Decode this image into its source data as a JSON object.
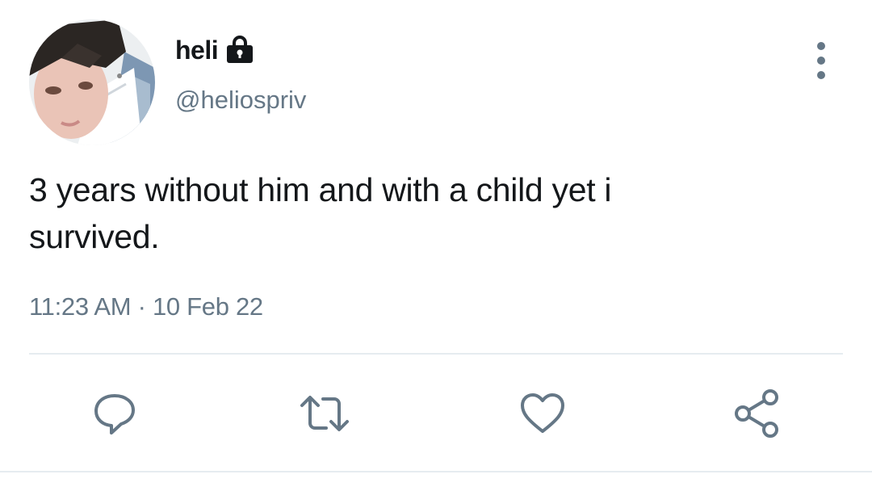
{
  "author": {
    "display_name": "heli",
    "handle": "@heliospriv",
    "avatar_icon": "avatar-photo",
    "protected_icon": "lock-icon"
  },
  "tweet": {
    "text_line_1": "3 years without him and with a child yet i",
    "text_line_2": "survived.",
    "time": "11:23 AM",
    "separator": "·",
    "date": "10 Feb 22"
  },
  "actions": {
    "reply_icon": "reply-icon",
    "retweet_icon": "retweet-icon",
    "like_icon": "heart-icon",
    "share_icon": "share-icon"
  },
  "colors": {
    "text_primary": "#14171a",
    "text_secondary": "#657786",
    "divider": "#e6ecf0"
  }
}
